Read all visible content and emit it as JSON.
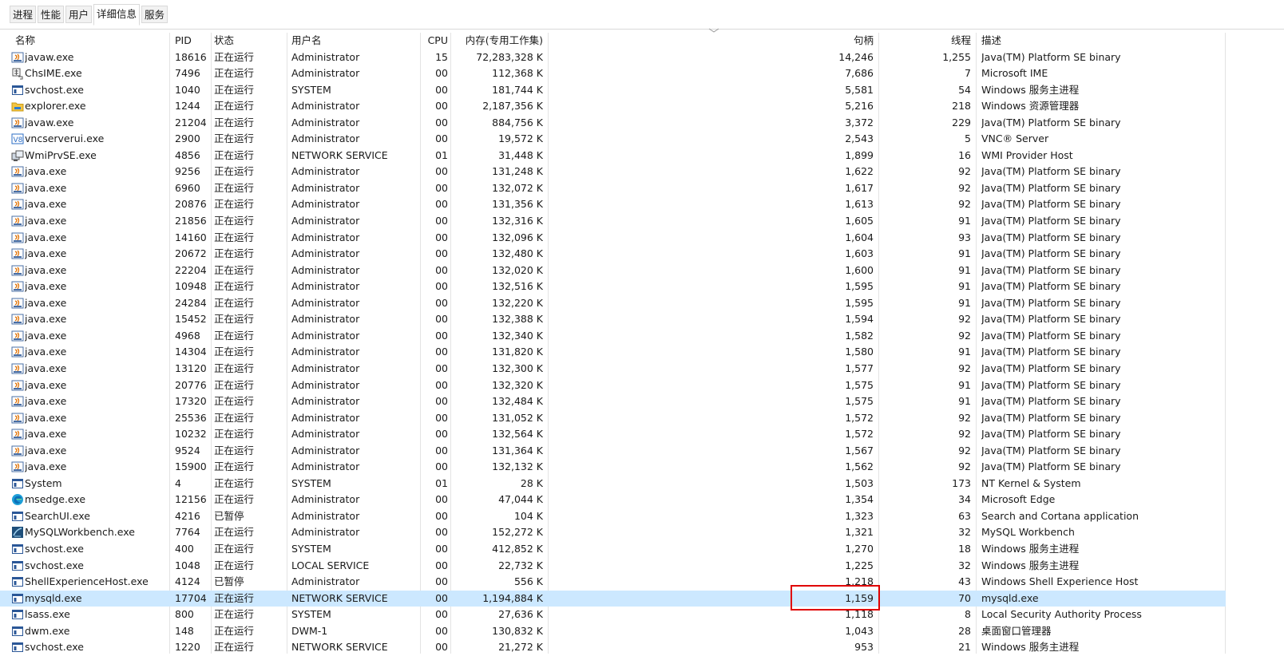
{
  "tabs": [
    {
      "label": "进程"
    },
    {
      "label": "性能"
    },
    {
      "label": "用户"
    },
    {
      "label": "详细信息",
      "active": true
    },
    {
      "label": "服务"
    }
  ],
  "columns": {
    "name": "名称",
    "pid": "PID",
    "status": "状态",
    "user": "用户名",
    "cpu": "CPU",
    "memory": "内存(专用工作集)",
    "handles": "句柄",
    "threads": "线程",
    "description": "描述"
  },
  "rows": [
    {
      "icon": "java-icon",
      "name": "javaw.exe",
      "pid": "18616",
      "status": "正在运行",
      "user": "Administrator",
      "cpu": "15",
      "mem": "72,283,328 K",
      "handles": "14,246",
      "threads": "1,255",
      "desc": "Java(TM) Platform SE binary"
    },
    {
      "icon": "ime-icon",
      "name": "ChsIME.exe",
      "pid": "7496",
      "status": "正在运行",
      "user": "Administrator",
      "cpu": "00",
      "mem": "112,368 K",
      "handles": "7,686",
      "threads": "7",
      "desc": "Microsoft IME"
    },
    {
      "icon": "app-window-icon",
      "name": "svchost.exe",
      "pid": "1040",
      "status": "正在运行",
      "user": "SYSTEM",
      "cpu": "00",
      "mem": "181,744 K",
      "handles": "5,581",
      "threads": "54",
      "desc": "Windows 服务主进程"
    },
    {
      "icon": "folder-icon",
      "name": "explorer.exe",
      "pid": "1244",
      "status": "正在运行",
      "user": "Administrator",
      "cpu": "00",
      "mem": "2,187,356 K",
      "handles": "5,216",
      "threads": "218",
      "desc": "Windows 资源管理器"
    },
    {
      "icon": "java-icon",
      "name": "javaw.exe",
      "pid": "21204",
      "status": "正在运行",
      "user": "Administrator",
      "cpu": "00",
      "mem": "884,756 K",
      "handles": "3,372",
      "threads": "229",
      "desc": "Java(TM) Platform SE binary"
    },
    {
      "icon": "vnc-icon",
      "name": "vncserverui.exe",
      "pid": "2900",
      "status": "正在运行",
      "user": "Administrator",
      "cpu": "00",
      "mem": "19,572 K",
      "handles": "2,543",
      "threads": "5",
      "desc": "VNC® Server"
    },
    {
      "icon": "wmi-icon",
      "name": "WmiPrvSE.exe",
      "pid": "4856",
      "status": "正在运行",
      "user": "NETWORK SERVICE",
      "cpu": "01",
      "mem": "31,448 K",
      "handles": "1,899",
      "threads": "16",
      "desc": "WMI Provider Host"
    },
    {
      "icon": "java-icon",
      "name": "java.exe",
      "pid": "9256",
      "status": "正在运行",
      "user": "Administrator",
      "cpu": "00",
      "mem": "131,248 K",
      "handles": "1,622",
      "threads": "92",
      "desc": "Java(TM) Platform SE binary"
    },
    {
      "icon": "java-icon",
      "name": "java.exe",
      "pid": "6960",
      "status": "正在运行",
      "user": "Administrator",
      "cpu": "00",
      "mem": "132,072 K",
      "handles": "1,617",
      "threads": "92",
      "desc": "Java(TM) Platform SE binary"
    },
    {
      "icon": "java-icon",
      "name": "java.exe",
      "pid": "20876",
      "status": "正在运行",
      "user": "Administrator",
      "cpu": "00",
      "mem": "131,356 K",
      "handles": "1,613",
      "threads": "92",
      "desc": "Java(TM) Platform SE binary"
    },
    {
      "icon": "java-icon",
      "name": "java.exe",
      "pid": "21856",
      "status": "正在运行",
      "user": "Administrator",
      "cpu": "00",
      "mem": "132,316 K",
      "handles": "1,605",
      "threads": "91",
      "desc": "Java(TM) Platform SE binary"
    },
    {
      "icon": "java-icon",
      "name": "java.exe",
      "pid": "14160",
      "status": "正在运行",
      "user": "Administrator",
      "cpu": "00",
      "mem": "132,096 K",
      "handles": "1,604",
      "threads": "93",
      "desc": "Java(TM) Platform SE binary"
    },
    {
      "icon": "java-icon",
      "name": "java.exe",
      "pid": "20672",
      "status": "正在运行",
      "user": "Administrator",
      "cpu": "00",
      "mem": "132,480 K",
      "handles": "1,603",
      "threads": "91",
      "desc": "Java(TM) Platform SE binary"
    },
    {
      "icon": "java-icon",
      "name": "java.exe",
      "pid": "22204",
      "status": "正在运行",
      "user": "Administrator",
      "cpu": "00",
      "mem": "132,020 K",
      "handles": "1,600",
      "threads": "91",
      "desc": "Java(TM) Platform SE binary"
    },
    {
      "icon": "java-icon",
      "name": "java.exe",
      "pid": "10948",
      "status": "正在运行",
      "user": "Administrator",
      "cpu": "00",
      "mem": "132,516 K",
      "handles": "1,595",
      "threads": "91",
      "desc": "Java(TM) Platform SE binary"
    },
    {
      "icon": "java-icon",
      "name": "java.exe",
      "pid": "24284",
      "status": "正在运行",
      "user": "Administrator",
      "cpu": "00",
      "mem": "132,220 K",
      "handles": "1,595",
      "threads": "91",
      "desc": "Java(TM) Platform SE binary"
    },
    {
      "icon": "java-icon",
      "name": "java.exe",
      "pid": "15452",
      "status": "正在运行",
      "user": "Administrator",
      "cpu": "00",
      "mem": "132,388 K",
      "handles": "1,594",
      "threads": "92",
      "desc": "Java(TM) Platform SE binary"
    },
    {
      "icon": "java-icon",
      "name": "java.exe",
      "pid": "4968",
      "status": "正在运行",
      "user": "Administrator",
      "cpu": "00",
      "mem": "132,340 K",
      "handles": "1,582",
      "threads": "92",
      "desc": "Java(TM) Platform SE binary"
    },
    {
      "icon": "java-icon",
      "name": "java.exe",
      "pid": "14304",
      "status": "正在运行",
      "user": "Administrator",
      "cpu": "00",
      "mem": "131,820 K",
      "handles": "1,580",
      "threads": "91",
      "desc": "Java(TM) Platform SE binary"
    },
    {
      "icon": "java-icon",
      "name": "java.exe",
      "pid": "13120",
      "status": "正在运行",
      "user": "Administrator",
      "cpu": "00",
      "mem": "132,300 K",
      "handles": "1,577",
      "threads": "92",
      "desc": "Java(TM) Platform SE binary"
    },
    {
      "icon": "java-icon",
      "name": "java.exe",
      "pid": "20776",
      "status": "正在运行",
      "user": "Administrator",
      "cpu": "00",
      "mem": "132,320 K",
      "handles": "1,575",
      "threads": "91",
      "desc": "Java(TM) Platform SE binary"
    },
    {
      "icon": "java-icon",
      "name": "java.exe",
      "pid": "17320",
      "status": "正在运行",
      "user": "Administrator",
      "cpu": "00",
      "mem": "132,484 K",
      "handles": "1,575",
      "threads": "91",
      "desc": "Java(TM) Platform SE binary"
    },
    {
      "icon": "java-icon",
      "name": "java.exe",
      "pid": "25536",
      "status": "正在运行",
      "user": "Administrator",
      "cpu": "00",
      "mem": "131,052 K",
      "handles": "1,572",
      "threads": "92",
      "desc": "Java(TM) Platform SE binary"
    },
    {
      "icon": "java-icon",
      "name": "java.exe",
      "pid": "10232",
      "status": "正在运行",
      "user": "Administrator",
      "cpu": "00",
      "mem": "132,564 K",
      "handles": "1,572",
      "threads": "92",
      "desc": "Java(TM) Platform SE binary"
    },
    {
      "icon": "java-icon",
      "name": "java.exe",
      "pid": "9524",
      "status": "正在运行",
      "user": "Administrator",
      "cpu": "00",
      "mem": "131,364 K",
      "handles": "1,567",
      "threads": "92",
      "desc": "Java(TM) Platform SE binary"
    },
    {
      "icon": "java-icon",
      "name": "java.exe",
      "pid": "15900",
      "status": "正在运行",
      "user": "Administrator",
      "cpu": "00",
      "mem": "132,132 K",
      "handles": "1,562",
      "threads": "92",
      "desc": "Java(TM) Platform SE binary"
    },
    {
      "icon": "app-window-icon",
      "name": "System",
      "pid": "4",
      "status": "正在运行",
      "user": "SYSTEM",
      "cpu": "01",
      "mem": "28 K",
      "handles": "1,503",
      "threads": "173",
      "desc": "NT Kernel & System"
    },
    {
      "icon": "edge-icon",
      "name": "msedge.exe",
      "pid": "12156",
      "status": "正在运行",
      "user": "Administrator",
      "cpu": "00",
      "mem": "47,044 K",
      "handles": "1,354",
      "threads": "34",
      "desc": "Microsoft Edge"
    },
    {
      "icon": "app-window-icon",
      "name": "SearchUI.exe",
      "pid": "4216",
      "status": "已暂停",
      "user": "Administrator",
      "cpu": "00",
      "mem": "104 K",
      "handles": "1,323",
      "threads": "63",
      "desc": "Search and Cortana application"
    },
    {
      "icon": "mysql-workbench-icon",
      "name": "MySQLWorkbench.exe",
      "pid": "7764",
      "status": "正在运行",
      "user": "Administrator",
      "cpu": "00",
      "mem": "152,272 K",
      "handles": "1,321",
      "threads": "32",
      "desc": "MySQL Workbench"
    },
    {
      "icon": "app-window-icon",
      "name": "svchost.exe",
      "pid": "400",
      "status": "正在运行",
      "user": "SYSTEM",
      "cpu": "00",
      "mem": "412,852 K",
      "handles": "1,270",
      "threads": "18",
      "desc": "Windows 服务主进程"
    },
    {
      "icon": "app-window-icon",
      "name": "svchost.exe",
      "pid": "1048",
      "status": "正在运行",
      "user": "LOCAL SERVICE",
      "cpu": "00",
      "mem": "22,732 K",
      "handles": "1,225",
      "threads": "32",
      "desc": "Windows 服务主进程"
    },
    {
      "icon": "app-window-icon",
      "name": "ShellExperienceHost.exe",
      "pid": "4124",
      "status": "已暂停",
      "user": "Administrator",
      "cpu": "00",
      "mem": "556 K",
      "handles": "1,218",
      "threads": "43",
      "desc": "Windows Shell Experience Host"
    },
    {
      "icon": "app-window-icon",
      "name": "mysqld.exe",
      "pid": "17704",
      "status": "正在运行",
      "user": "NETWORK SERVICE",
      "cpu": "00",
      "mem": "1,194,884 K",
      "handles": "1,159",
      "threads": "70",
      "desc": "mysqld.exe",
      "selected": true
    },
    {
      "icon": "app-window-icon",
      "name": "lsass.exe",
      "pid": "800",
      "status": "正在运行",
      "user": "SYSTEM",
      "cpu": "00",
      "mem": "27,636 K",
      "handles": "1,118",
      "threads": "8",
      "desc": "Local Security Authority Process"
    },
    {
      "icon": "app-window-icon",
      "name": "dwm.exe",
      "pid": "148",
      "status": "正在运行",
      "user": "DWM-1",
      "cpu": "00",
      "mem": "130,832 K",
      "handles": "1,043",
      "threads": "28",
      "desc": "桌面窗口管理器"
    },
    {
      "icon": "app-window-icon",
      "name": "svchost.exe",
      "pid": "1220",
      "status": "正在运行",
      "user": "NETWORK SERVICE",
      "cpu": "00",
      "mem": "21,272 K",
      "handles": "953",
      "threads": "21",
      "desc": "Windows 服务主进程"
    }
  ],
  "colors": {
    "selected_row": "#cce8ff",
    "annotation_box": "#e00000"
  }
}
